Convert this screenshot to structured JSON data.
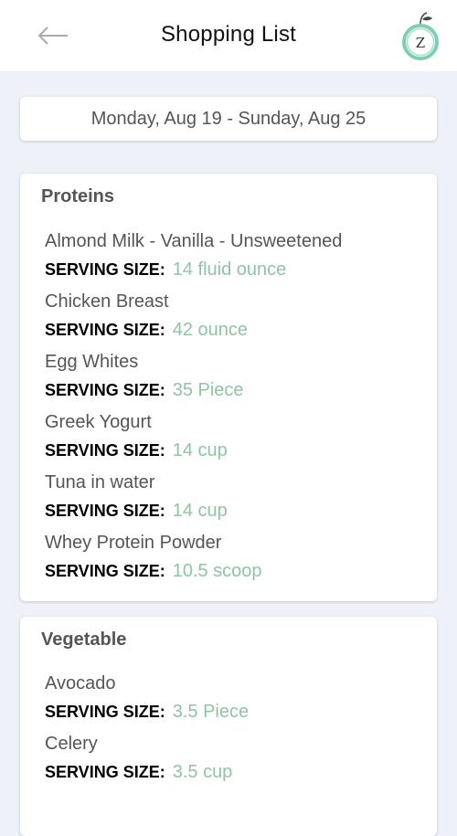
{
  "header": {
    "title": "Shopping List",
    "back_icon": "arrow-left-icon",
    "logo_letter": "Z",
    "logo_icon": "apple-logo-icon"
  },
  "date_range": "Monday, Aug 19 - Sunday, Aug 25",
  "serving_label": "SERVING SIZE:",
  "colors": {
    "accent_green": "#8fc4a4",
    "background": "#eef1f7"
  },
  "categories": [
    {
      "name": "Proteins",
      "items": [
        {
          "name": "Almond Milk - Vanilla - Unsweetened",
          "serving": "14 fluid ounce"
        },
        {
          "name": "Chicken Breast",
          "serving": "42 ounce"
        },
        {
          "name": "Egg Whites",
          "serving": "35 Piece"
        },
        {
          "name": "Greek Yogurt",
          "serving": "14 cup"
        },
        {
          "name": "Tuna in water",
          "serving": "14 cup"
        },
        {
          "name": "Whey Protein Powder",
          "serving": "10.5 scoop"
        }
      ]
    },
    {
      "name": "Vegetable",
      "items": [
        {
          "name": "Avocado",
          "serving": "3.5 Piece"
        },
        {
          "name": "Celery",
          "serving": "3.5 cup"
        }
      ]
    }
  ]
}
